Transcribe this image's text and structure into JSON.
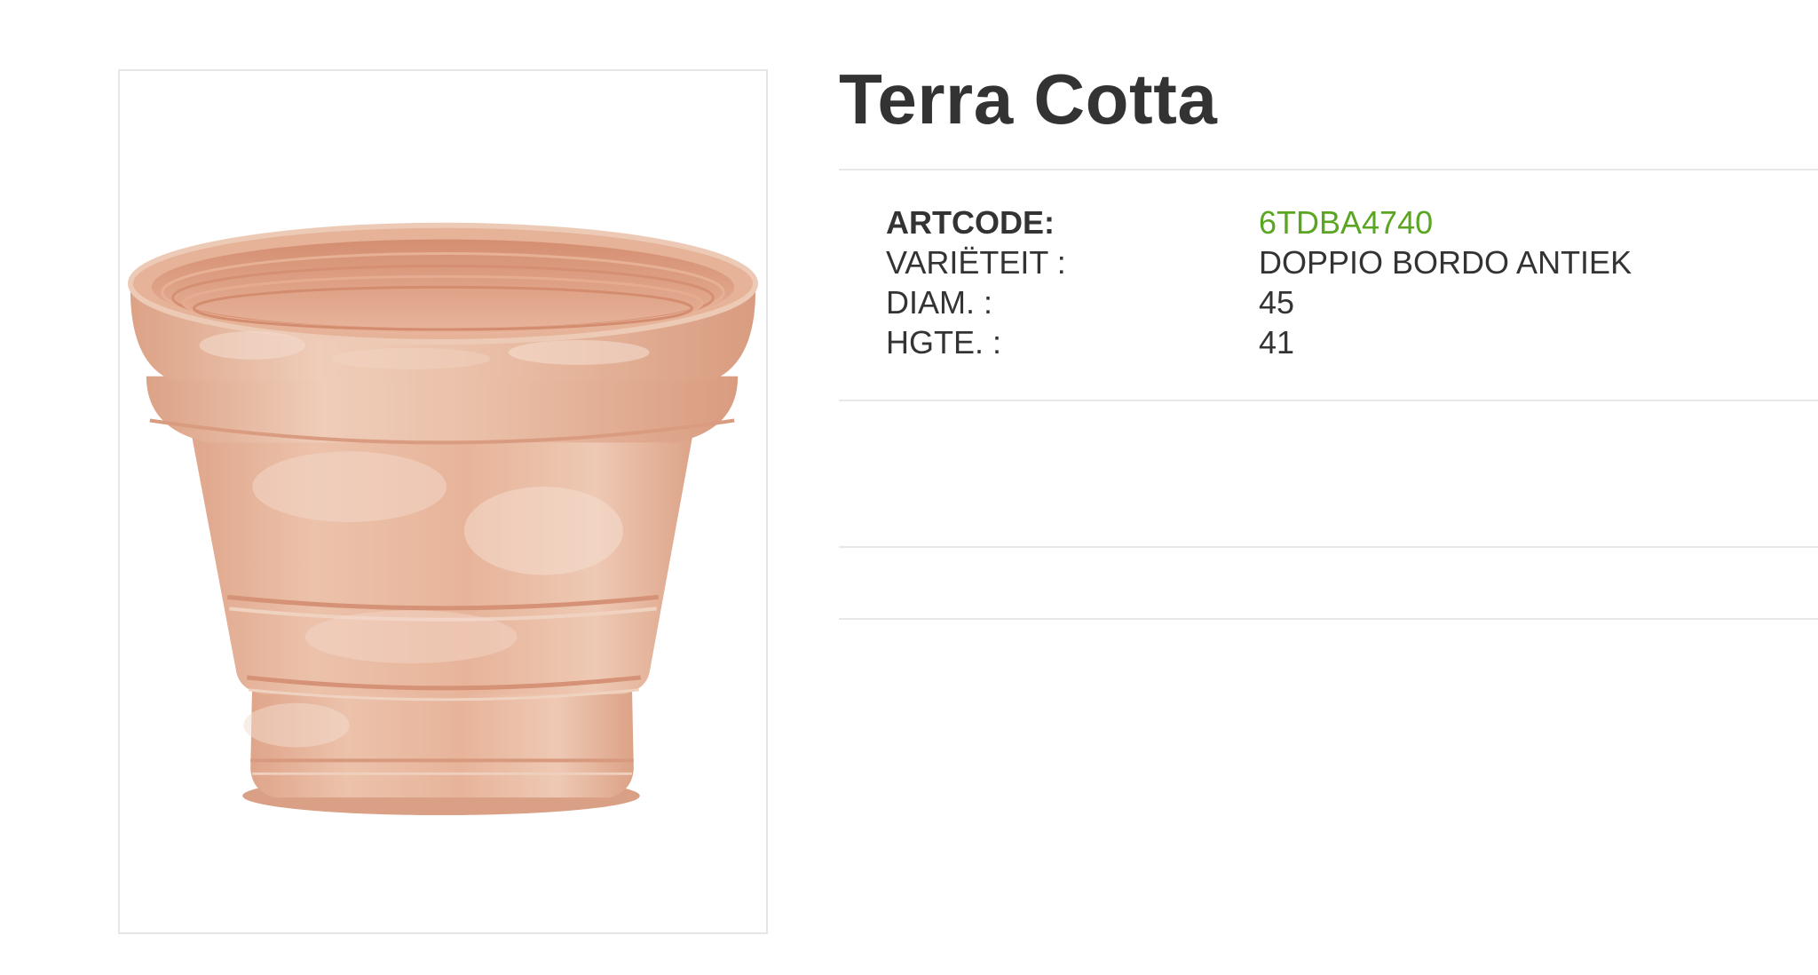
{
  "product": {
    "title": "Terra Cotta",
    "image": {
      "icon": "terracotta-pot-image",
      "colors": {
        "body": "#e8b9a0",
        "rim": "#e2ad93",
        "shadow": "#d99a7d",
        "highlight": "#f3dccd",
        "inner": "#dba083"
      }
    },
    "specs": {
      "artcode": {
        "label": "ARTCODE:",
        "value": "6TDBA4740"
      },
      "variety": {
        "label": "VARIËTEIT :",
        "value": "DOPPIO BORDO ANTIEK"
      },
      "diameter": {
        "label": "DIAM. :",
        "value": "45"
      },
      "height": {
        "label": "HGTE. :",
        "value": "41"
      }
    }
  },
  "colors": {
    "accent": "#5aa521",
    "text": "#333333",
    "divider": "#e8e8e8",
    "frame": "#e6e6e6"
  }
}
